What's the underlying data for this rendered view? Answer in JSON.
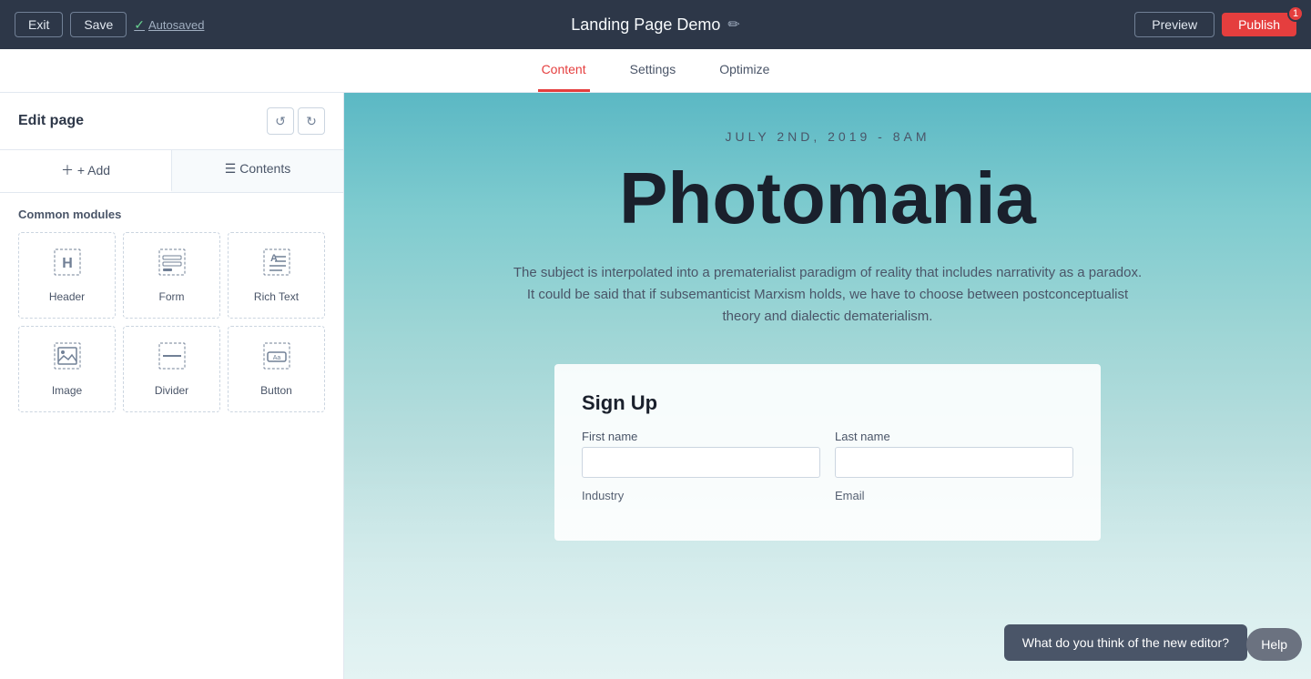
{
  "topbar": {
    "exit_label": "Exit",
    "save_label": "Save",
    "autosaved_label": "Autosaved",
    "page_title": "Landing Page Demo",
    "preview_label": "Preview",
    "publish_label": "Publish",
    "publish_badge": "1",
    "edit_icon": "✏"
  },
  "navtabs": {
    "tabs": [
      {
        "id": "content",
        "label": "Content",
        "active": true
      },
      {
        "id": "settings",
        "label": "Settings",
        "active": false
      },
      {
        "id": "optimize",
        "label": "Optimize",
        "active": false
      }
    ]
  },
  "sidebar": {
    "title": "Edit page",
    "add_tab_label": "+ Add",
    "contents_tab_label": "Contents",
    "modules_section_title": "Common modules",
    "modules": [
      {
        "id": "header",
        "label": "Header",
        "icon": "H"
      },
      {
        "id": "form",
        "label": "Form",
        "icon": "form"
      },
      {
        "id": "rich-text",
        "label": "Rich Text",
        "icon": "rich-text"
      },
      {
        "id": "image",
        "label": "Image",
        "icon": "image"
      },
      {
        "id": "divider",
        "label": "Divider",
        "icon": "divider"
      },
      {
        "id": "button",
        "label": "Button",
        "icon": "button"
      }
    ]
  },
  "canvas": {
    "event_date": "JULY 2ND, 2019 - 8AM",
    "event_title": "Photomania",
    "event_desc": "The subject is interpolated into a prematerialist paradigm of reality that includes narrativity as a paradox. It could be said that if subsemanticist Marxism holds, we have to choose between postconceptualist theory and dialectic dematerialism.",
    "signup_title": "Sign Up",
    "form": {
      "first_name_label": "First name",
      "last_name_label": "Last name",
      "industry_label": "Industry",
      "email_label": "Email",
      "first_name_placeholder": "",
      "last_name_placeholder": "",
      "industry_placeholder": "",
      "email_placeholder": ""
    }
  },
  "chat": {
    "message": "What do you think of the new editor?",
    "help_label": "Help"
  }
}
